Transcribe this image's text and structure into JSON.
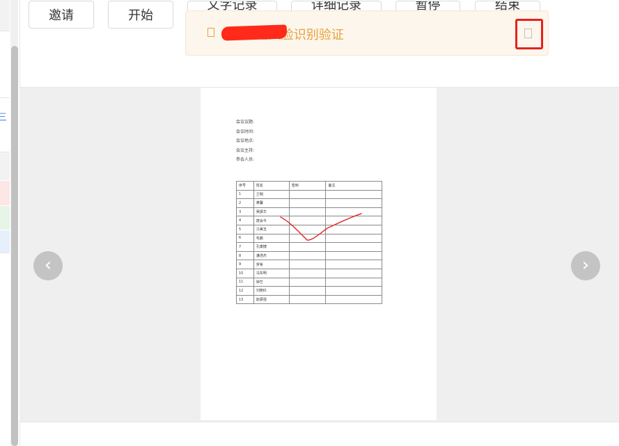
{
  "toolbar": {
    "buttons": [
      "邀请",
      "开始",
      "文字记录",
      "详细记录",
      "暂停",
      "结束"
    ]
  },
  "notice": {
    "message": "刘       通过人脸识别验证"
  },
  "sidebar": {
    "glyph": "三"
  },
  "viewer": {
    "prev_icon": "chevron-left-icon",
    "prev_glyph": "‹",
    "next_icon": "chevron-right-icon",
    "next_glyph": "›"
  },
  "document": {
    "fields": [
      "会议议题:",
      "会议时间:",
      "会议地点:",
      "会议主持:",
      "参会人员:"
    ],
    "table_headers": [
      "序号",
      "姓名",
      "签到",
      "备注"
    ],
    "rows": [
      [
        "1",
        "兰明"
      ],
      [
        "2",
        "黄馨"
      ],
      [
        "3",
        "吴振华"
      ],
      [
        "4",
        "唐会今"
      ],
      [
        "5",
        "江美玉"
      ],
      [
        "6",
        "毛鹏"
      ],
      [
        "7",
        "孔康捷"
      ],
      [
        "8",
        "潘浩杰"
      ],
      [
        "9",
        "罗希"
      ],
      [
        "10",
        "马东明"
      ],
      [
        "11",
        "钟艺"
      ],
      [
        "12",
        "刘丽红"
      ],
      [
        "13",
        "赵振强"
      ]
    ]
  },
  "colors": {
    "notice_text": "#e6a23c",
    "notice_bg": "#fdf6ec",
    "highlight": "#e8201a",
    "signature": "#e03030"
  }
}
